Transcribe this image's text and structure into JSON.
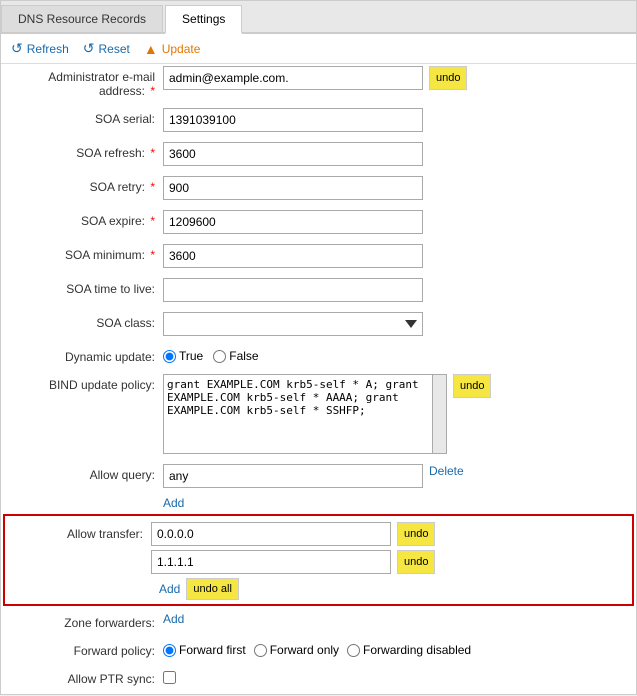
{
  "tabs": [
    {
      "label": "DNS Resource Records",
      "active": false
    },
    {
      "label": "Settings",
      "active": true
    }
  ],
  "toolbar": {
    "refresh_label": "Refresh",
    "reset_label": "Reset",
    "update_label": "Update"
  },
  "form": {
    "admin_email_label": "Administrator e-mail address:",
    "admin_email_value": "admin@example.com.",
    "soa_serial_label": "SOA serial:",
    "soa_serial_value": "1391039100",
    "soa_refresh_label": "SOA refresh:",
    "soa_refresh_value": "3600",
    "soa_retry_label": "SOA retry:",
    "soa_retry_value": "900",
    "soa_expire_label": "SOA expire:",
    "soa_expire_value": "1209600",
    "soa_minimum_label": "SOA minimum:",
    "soa_minimum_value": "3600",
    "soa_ttl_label": "SOA time to live:",
    "soa_ttl_value": "",
    "soa_class_label": "SOA class:",
    "soa_class_value": "",
    "dynamic_update_label": "Dynamic update:",
    "dynamic_update_true": "True",
    "dynamic_update_false": "False",
    "bind_policy_label": "BIND update policy:",
    "bind_policy_value": "grant EXAMPLE.COM krb5-self * A; grant\nEXAMPLE.COM krb5-self * AAAA; grant\nEXAMPLE.COM krb5-self * SSHFP;",
    "allow_query_label": "Allow query:",
    "allow_query_value": "any",
    "delete_label": "Delete",
    "add_label": "Add",
    "allow_transfer_label": "Allow transfer:",
    "transfer_value1": "0.0.0.0",
    "transfer_value2": "1.1.1.1",
    "undo_label": "undo",
    "undo_all_label": "undo all",
    "zone_forwarders_label": "Zone forwarders:",
    "forward_policy_label": "Forward policy:",
    "forward_first": "Forward first",
    "forward_only": "Forward only",
    "forwarding_disabled": "Forwarding disabled",
    "allow_ptr_sync_label": "Allow PTR sync:"
  }
}
